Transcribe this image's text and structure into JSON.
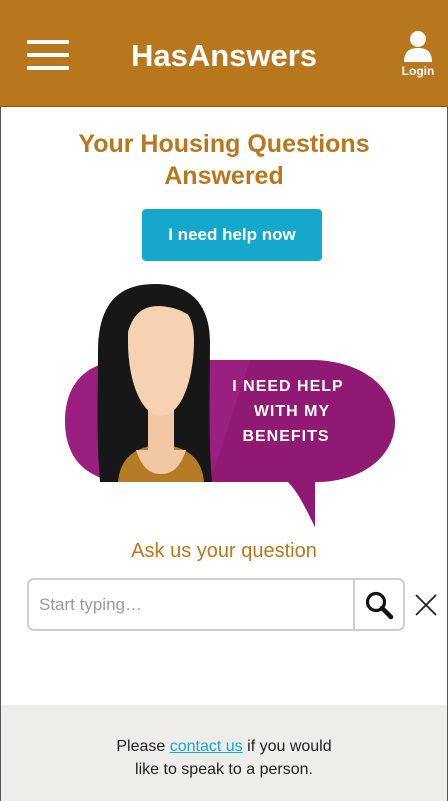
{
  "header": {
    "brand": "HasAnswers",
    "login_label": "Login"
  },
  "hero": {
    "headline_line1": "Your Housing Questions",
    "headline_line2": "Answered",
    "help_button": "I need help now",
    "bubble_line1": "I NEED HELP",
    "bubble_line2": "WITH MY",
    "bubble_line3": "BENEFITS"
  },
  "search": {
    "label": "Ask us your question",
    "placeholder": "Start typing…"
  },
  "footer": {
    "text_before": "Please ",
    "link_text": "contact us",
    "text_after": " if you would",
    "text_line2": "like to speak to a person."
  },
  "colors": {
    "brand": "#b8771c",
    "accent": "#16a8cc",
    "bubble": "#9b1f7e",
    "footer_bg": "#eeedea"
  },
  "icons": [
    "menu-icon",
    "user-icon",
    "search-icon",
    "close-icon"
  ]
}
